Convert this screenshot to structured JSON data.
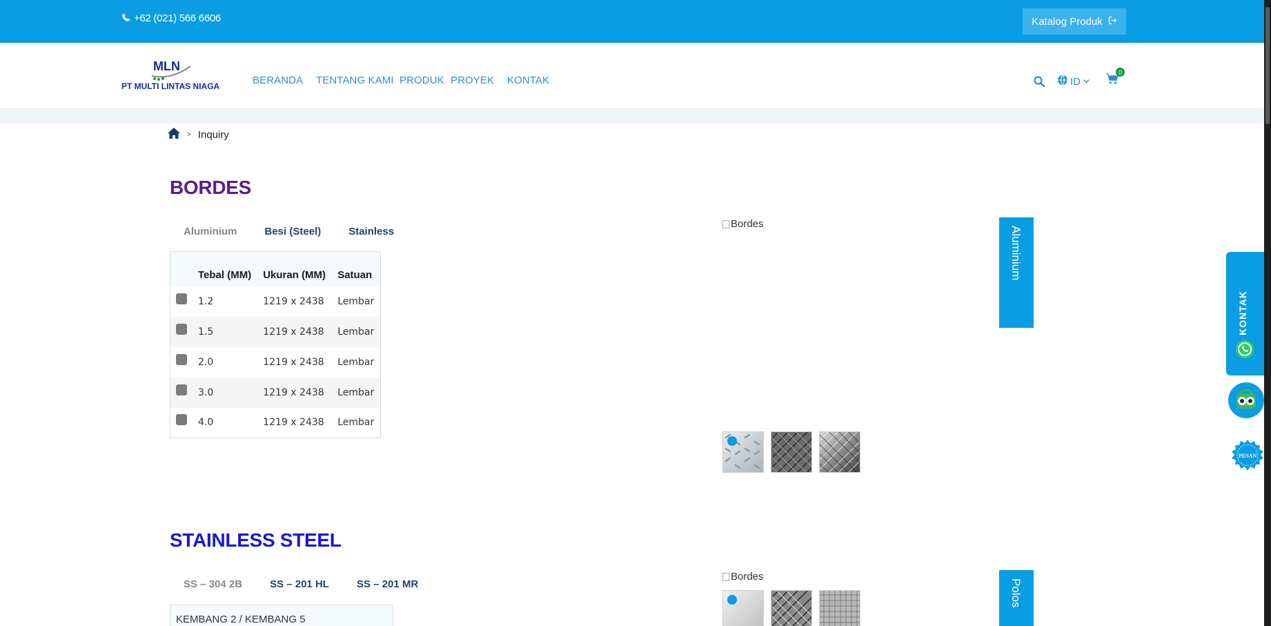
{
  "topbar": {
    "phone": "+62 (021) 566 6606",
    "catalog_button": "Katalog Produk"
  },
  "logo": {
    "mark": "MLN",
    "company": "PT MULTI LINTAS NIAGA"
  },
  "nav": {
    "items": [
      {
        "label": "BERANDA"
      },
      {
        "label": "TENTANG KAMI"
      },
      {
        "label": "PRODUK"
      },
      {
        "label": "PROYEK"
      },
      {
        "label": "KONTAK"
      }
    ],
    "language": "ID",
    "cart_count": "0"
  },
  "breadcrumb": {
    "separator": ">",
    "current": "Inquiry"
  },
  "section1": {
    "title": "BORDES",
    "tabs": [
      "Aluminium",
      "Besi (Steel)",
      "Stainless"
    ],
    "table": {
      "headers": [
        "Tebal (MM)",
        "Ukuran (MM)",
        "Satuan"
      ],
      "rows": [
        [
          "1.2",
          "1219 x 2438",
          "Lembar"
        ],
        [
          "1.5",
          "1219 x 2438",
          "Lembar"
        ],
        [
          "2.0",
          "1219 x 2438",
          "Lembar"
        ],
        [
          "3.0",
          "1219 x 2438",
          "Lembar"
        ],
        [
          "4.0",
          "1219 x 2438",
          "Lembar"
        ]
      ]
    },
    "image_alt": "Bordes",
    "side_label": "Aluminium"
  },
  "section2": {
    "title": "STAINLESS STEEL",
    "tabs": [
      "SS – 304 2B",
      "SS – 201 HL",
      "SS – 201 MR"
    ],
    "table_first_row": "KEMBANG 2 / KEMBANG 5",
    "image_alt": "Bordes",
    "side_label": "Polos"
  },
  "floating": {
    "kontak": "KONTAK",
    "pesan": "PESAN"
  },
  "colors": {
    "primary": "#0a9de3",
    "title1": "#5b1a8e",
    "title2": "#1a17d6",
    "nav": "#2f8fce"
  }
}
